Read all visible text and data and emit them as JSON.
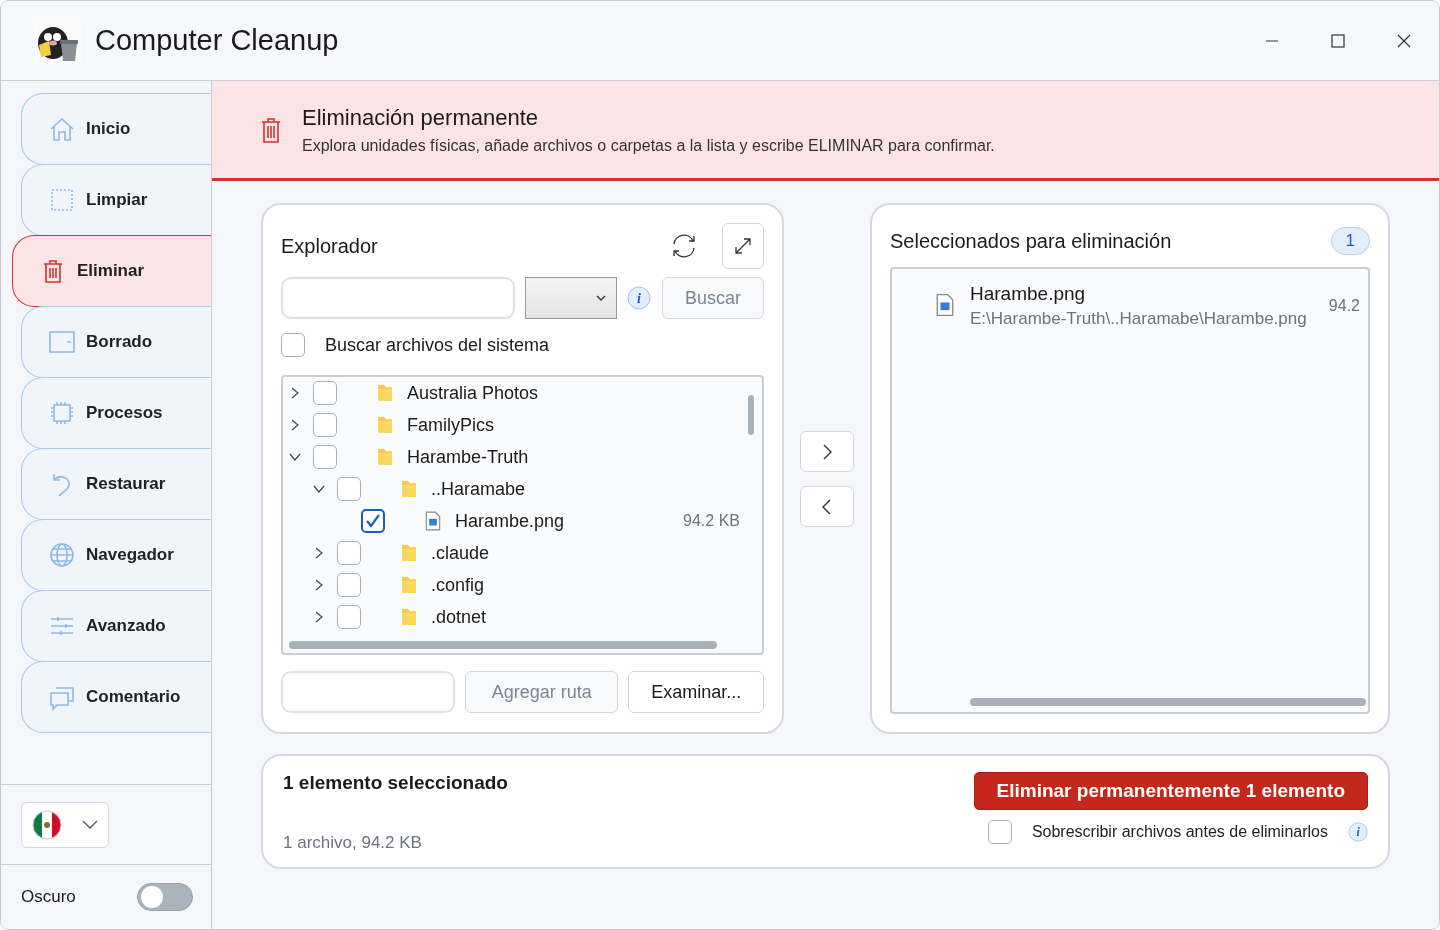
{
  "window": {
    "title": "Computer Cleanup"
  },
  "sidebar": {
    "items": [
      {
        "label": "Inicio",
        "selected": false
      },
      {
        "label": "Limpiar",
        "selected": false
      },
      {
        "label": "Eliminar",
        "selected": true
      },
      {
        "label": "Borrado",
        "selected": false
      },
      {
        "label": "Procesos",
        "selected": false
      },
      {
        "label": "Restaurar",
        "selected": false
      },
      {
        "label": "Navegador",
        "selected": false
      },
      {
        "label": "Avanzado",
        "selected": false
      },
      {
        "label": "Comentario",
        "selected": false
      }
    ],
    "dark_mode": {
      "label": "Oscuro",
      "on": false
    }
  },
  "banner": {
    "title": "Eliminación permanente",
    "text": "Explora unidades físicas, añade archivos o carpetas a la lista y escribe ELIMINAR para confirmar."
  },
  "explorer": {
    "title": "Explorador",
    "info_icon": "i",
    "search_button": {
      "label": "Buscar",
      "disabled": true
    },
    "system_files": {
      "label": "Buscar archivos del sistema",
      "checked": false
    },
    "tree": [
      {
        "name": "Australia Photos",
        "kind": "folder",
        "checked": false,
        "expanded": false
      },
      {
        "name": "FamilyPics",
        "kind": "folder",
        "checked": false,
        "expanded": false
      },
      {
        "name": "Harambe-Truth",
        "kind": "folder",
        "checked": false,
        "expanded": true,
        "children": [
          {
            "name": "..Haramabe",
            "kind": "folder",
            "checked": false,
            "expanded": true,
            "children": [
              {
                "name": "Harambe.png",
                "kind": "file",
                "checked": true,
                "size": "94.2 KB"
              }
            ]
          },
          {
            "name": ".claude",
            "kind": "folder",
            "checked": false,
            "expanded": false
          },
          {
            "name": ".config",
            "kind": "folder",
            "checked": false,
            "expanded": false
          },
          {
            "name": ".dotnet",
            "kind": "folder",
            "checked": false,
            "expanded": false
          }
        ]
      }
    ],
    "add_path_button": {
      "label": "Agregar ruta",
      "disabled": true
    },
    "browse_button": {
      "label": "Examinar...",
      "disabled": false
    }
  },
  "selected_panel": {
    "title": "Seleccionados para eliminación",
    "count": "1",
    "items": [
      {
        "name": "Harambe.png",
        "path": "E:\\Harambe-Truth\\..Haramabe\\Harambe.png",
        "size": "94.2"
      }
    ]
  },
  "footer": {
    "summary": "1 elemento seleccionado",
    "details": "1 archivo, 94.2 KB",
    "delete_button": "Eliminar permanentemente 1 elemento",
    "overwrite": {
      "label": "Sobrescribir archivos antes de eliminarlos",
      "checked": false
    },
    "info_icon": "i"
  }
}
